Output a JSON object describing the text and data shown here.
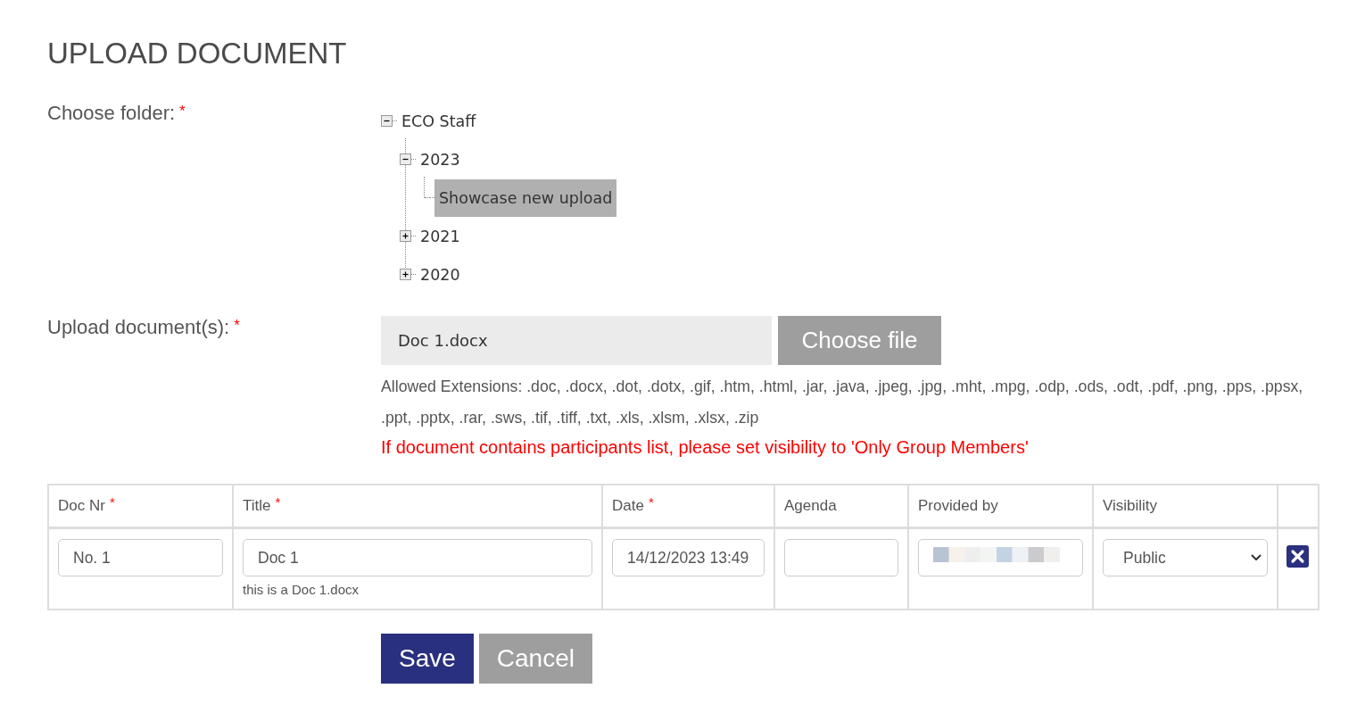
{
  "page": {
    "title": "UPLOAD DOCUMENT"
  },
  "folder": {
    "label": "Choose folder:",
    "required_mark": "*",
    "tree": [
      {
        "label": "ECO Staff",
        "expanded": true,
        "selected": false,
        "children": [
          {
            "label": "2023",
            "expanded": true,
            "selected": false,
            "children": [
              {
                "label": "Showcase new upload",
                "selected": true
              }
            ]
          },
          {
            "label": "2021",
            "expanded": false,
            "selected": false
          },
          {
            "label": "2020",
            "expanded": false,
            "selected": false
          }
        ]
      }
    ]
  },
  "upload": {
    "label": "Upload document(s):",
    "required_mark": "*",
    "file_name": "Doc 1.docx",
    "button": "Choose file",
    "allowed_extensions": "Allowed Extensions: .doc, .docx, .dot, .dotx, .gif, .htm, .html, .jar, .java, .jpeg, .jpg, .mht, .mpg, .odp, .ods, .odt, .pdf, .png, .pps, .ppsx, .ppt, .pptx, .rar, .sws, .tif, .tiff, .txt, .xls, .xlsm, .xlsx, .zip",
    "warning": "If document contains participants list, please set visibility to 'Only Group Members'"
  },
  "table": {
    "columns": [
      {
        "label": "Doc Nr",
        "required_mark": "*"
      },
      {
        "label": "Title",
        "required_mark": "*"
      },
      {
        "label": "Date",
        "required_mark": "*"
      },
      {
        "label": "Agenda"
      },
      {
        "label": "Provided by"
      },
      {
        "label": "Visibility"
      }
    ],
    "rows": [
      {
        "removable": true,
        "cells": [
          {
            "kind": "text",
            "value": "No. 1"
          },
          {
            "kind": "text",
            "value": "Doc 1",
            "note": "this is a Doc 1.docx"
          },
          {
            "kind": "text",
            "value": "14/12/2023 13:49"
          },
          {
            "kind": "text"
          },
          {
            "kind": "redacted"
          },
          {
            "kind": "select",
            "value": "Public"
          }
        ]
      }
    ]
  },
  "buttons": [
    {
      "kind": "save",
      "label": "Save"
    },
    {
      "kind": "cancel",
      "label": "Cancel"
    }
  ]
}
